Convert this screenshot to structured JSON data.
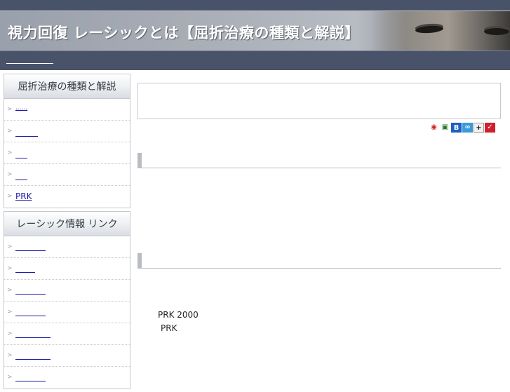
{
  "banner": {
    "title": "視力回復 レーシックとは【屈折治療の種類と解説】"
  },
  "sidebar": {
    "section1": {
      "heading": "屈折治療の種類と解説",
      "items": [
        {
          "label": "......"
        },
        {
          "label": ""
        },
        {
          "label": ""
        },
        {
          "label": ""
        },
        {
          "label": "PRK"
        }
      ]
    },
    "section2": {
      "heading": "レーシック情報 リンク",
      "items": [
        {
          "label": ""
        },
        {
          "label": ""
        },
        {
          "label": ""
        },
        {
          "label": ""
        },
        {
          "label": ""
        },
        {
          "label": ""
        },
        {
          "label": ""
        }
      ]
    }
  },
  "share_icons": [
    "yahoo-bookmark-icon",
    "google-bookmark-icon",
    "hatena-bookmark-icon",
    "livedoor-clip-icon",
    "delicious-icon",
    "buzzurl-icon"
  ],
  "main": {
    "line1": "PRK  2000",
    "line2": "PRK"
  },
  "colors": {
    "topbar": "#48536a",
    "link": "#1a1aa6"
  }
}
